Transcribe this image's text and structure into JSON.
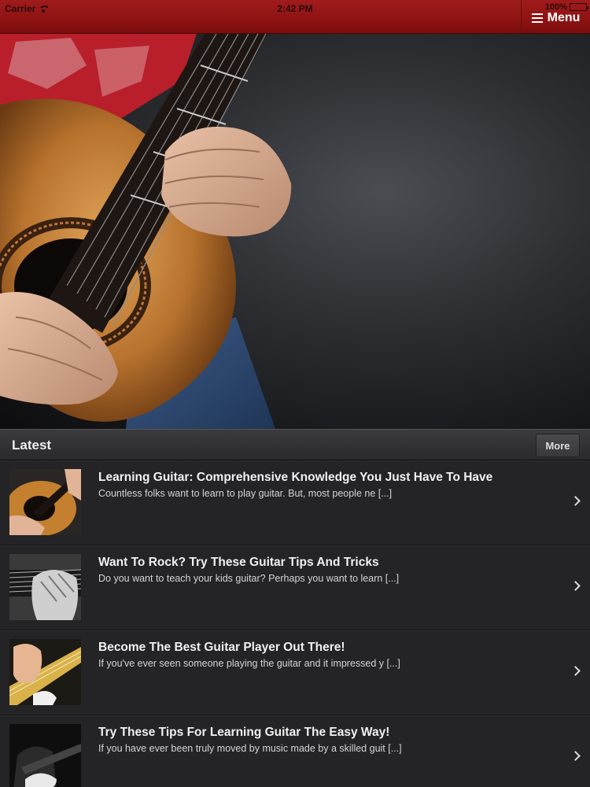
{
  "status_bar": {
    "carrier": "Carrier",
    "time": "2:42 PM",
    "battery": "100%"
  },
  "header": {
    "menu_label": "Menu"
  },
  "section": {
    "title": "Latest",
    "more_label": "More"
  },
  "posts": [
    {
      "title": "Learning Guitar: Comprehensive Knowledge You Just Have To Have",
      "excerpt": "Countless folks want to learn to play guitar. But, most people ne [...]"
    },
    {
      "title": "Want To Rock? Try These Guitar Tips And Tricks",
      "excerpt": "Do you want to teach your kids guitar? Perhaps you want to learn [...]"
    },
    {
      "title": "Become The Best Guitar Player Out There!",
      "excerpt": "If you've ever seen someone playing the guitar and it impressed y [...]"
    },
    {
      "title": "Try These Tips For Learning Guitar The Easy Way!",
      "excerpt": "If you have ever been truly moved by music made by a skilled guit [...]"
    }
  ],
  "icons": {
    "menu": "hamburger-icon",
    "row_arrow": "chevron-right-icon",
    "wifi": "wifi-icon",
    "battery": "battery-icon"
  },
  "colors": {
    "header_red": "#8e1313",
    "list_bg": "#242426",
    "text": "#f1f1f1"
  }
}
